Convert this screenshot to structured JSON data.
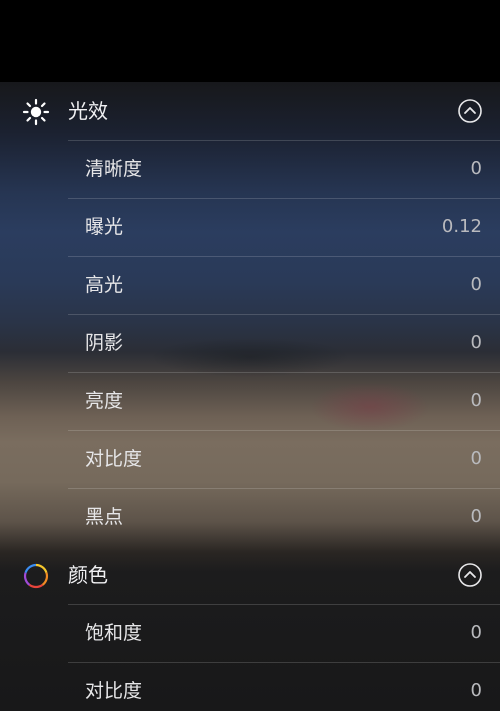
{
  "sections": [
    {
      "title": "光效",
      "icon": "sun-icon",
      "items": [
        {
          "label": "清晰度",
          "value": "0"
        },
        {
          "label": "曝光",
          "value": "0.12"
        },
        {
          "label": "高光",
          "value": "0"
        },
        {
          "label": "阴影",
          "value": "0"
        },
        {
          "label": "亮度",
          "value": "0"
        },
        {
          "label": "对比度",
          "value": "0"
        },
        {
          "label": "黑点",
          "value": "0"
        }
      ]
    },
    {
      "title": "颜色",
      "icon": "color-wheel-icon",
      "items": [
        {
          "label": "饱和度",
          "value": "0"
        },
        {
          "label": "对比度",
          "value": "0"
        }
      ]
    }
  ]
}
